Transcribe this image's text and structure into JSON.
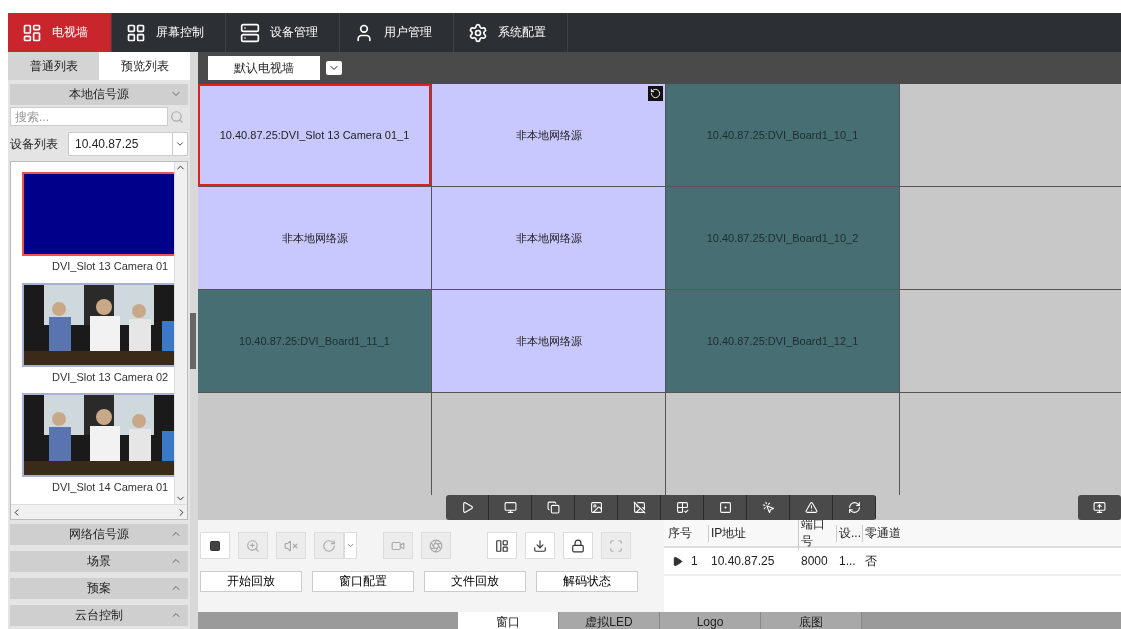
{
  "nav": [
    {
      "label": "电视墙",
      "selected": true
    },
    {
      "label": "屏幕控制",
      "selected": false
    },
    {
      "label": "设备管理",
      "selected": false
    },
    {
      "label": "用户管理",
      "selected": false
    },
    {
      "label": "系统配置",
      "selected": false
    }
  ],
  "sidebar": {
    "tabs": [
      {
        "label": "普通列表",
        "selected": false
      },
      {
        "label": "预览列表",
        "selected": true
      }
    ],
    "local_source": {
      "title": "本地信号源",
      "expanded": true,
      "search": {
        "placeholder": "搜索..."
      },
      "device_label": "设备列表",
      "device_value": "10.40.87.25",
      "thumbnails": [
        {
          "caption": "DVI_Slot 13 Camera 01",
          "kind": "blank",
          "selected": true
        },
        {
          "caption": "DVI_Slot 13 Camera 02",
          "kind": "picture",
          "selected": false
        },
        {
          "caption": "DVI_Slot 14 Camera 01",
          "kind": "picture",
          "selected": false
        }
      ]
    },
    "sections": [
      {
        "title": "网络信号源",
        "expanded": false
      },
      {
        "title": "场景",
        "expanded": false
      },
      {
        "title": "预案",
        "expanded": false
      },
      {
        "title": "云台控制",
        "expanded": false
      }
    ]
  },
  "wall_select": {
    "value": "默认电视墙"
  },
  "wall": {
    "cells": [
      {
        "kind": "local",
        "text": "10.40.87.25:DVI_Slot 13 Camera 01_1",
        "selected": true,
        "rotated": false
      },
      {
        "kind": "network",
        "text": "非本地网络源",
        "selected": false,
        "rotated": true
      },
      {
        "kind": "board",
        "text": "10.40.87.25:DVI_Board1_10_1",
        "selected": false,
        "rotated": false
      },
      {
        "kind": "empty",
        "selected": false,
        "rotated": false
      },
      {
        "kind": "network",
        "text": "非本地网络源",
        "selected": false,
        "rotated": false
      },
      {
        "kind": "network",
        "text": "非本地网络源",
        "selected": false,
        "rotated": false
      },
      {
        "kind": "board",
        "text": "10.40.87.25:DVI_Board1_10_2",
        "selected": false,
        "rotated": false
      },
      {
        "kind": "empty",
        "selected": false,
        "rotated": false
      },
      {
        "kind": "board",
        "text": "10.40.87.25:DVI_Board1_11_1",
        "selected": false,
        "rotated": false
      },
      {
        "kind": "network",
        "text": "非本地网络源",
        "selected": false,
        "rotated": false
      },
      {
        "kind": "board",
        "text": "10.40.87.25:DVI_Board1_12_1",
        "selected": false,
        "rotated": false
      },
      {
        "kind": "empty",
        "selected": false,
        "rotated": false
      },
      {
        "kind": "empty",
        "selected": false,
        "rotated": false
      },
      {
        "kind": "empty",
        "selected": false,
        "rotated": false
      },
      {
        "kind": "empty",
        "selected": false,
        "rotated": false
      },
      {
        "kind": "empty",
        "selected": false,
        "rotated": false
      }
    ]
  },
  "controls": [
    {
      "disabled": false
    },
    {
      "disabled": true
    },
    {
      "disabled": true
    },
    {
      "disabled": true
    },
    {
      "disabled": true
    },
    {
      "disabled": true
    },
    {
      "disabled": false
    },
    {
      "disabled": false
    },
    {
      "disabled": false
    },
    {
      "disabled": true
    }
  ],
  "action_buttons": [
    "开始回放",
    "窗口配置",
    "文件回放",
    "解码状态"
  ],
  "device_table": {
    "columns": [
      "序号",
      "IP地址",
      "端口号",
      "设...",
      "零通道"
    ],
    "rows": [
      {
        "cells": [
          "1",
          "10.40.87.25",
          "8000",
          "1...",
          "否"
        ]
      }
    ]
  },
  "bottom_tabs": [
    {
      "label": "窗口",
      "selected": true
    },
    {
      "label": "虚拟LED",
      "selected": false
    },
    {
      "label": "Logo",
      "selected": false
    },
    {
      "label": "底图",
      "selected": false
    }
  ]
}
